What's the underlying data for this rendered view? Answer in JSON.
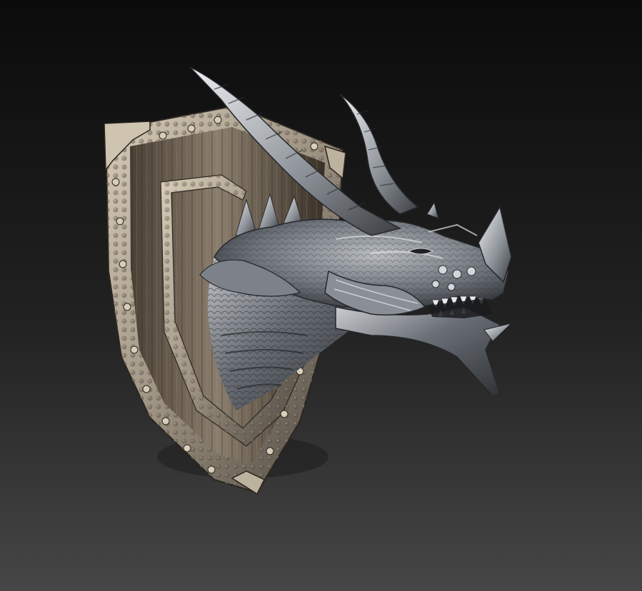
{
  "scene": {
    "subject_icon": "dragon-head-trophy-icon",
    "colors": {
      "background_top": "#0b0b0b",
      "background_bottom": "#464646",
      "wood_dark": "#3a3128",
      "wood_light": "#8b7e6d",
      "trim_metal": "#9d9281",
      "trim_highlight": "#d8cdb9",
      "dragon_dark": "#2f3236",
      "dragon_mid": "#6a6f76",
      "dragon_light": "#c9ccd0",
      "dragon_highlight": "#eef0f2"
    }
  }
}
